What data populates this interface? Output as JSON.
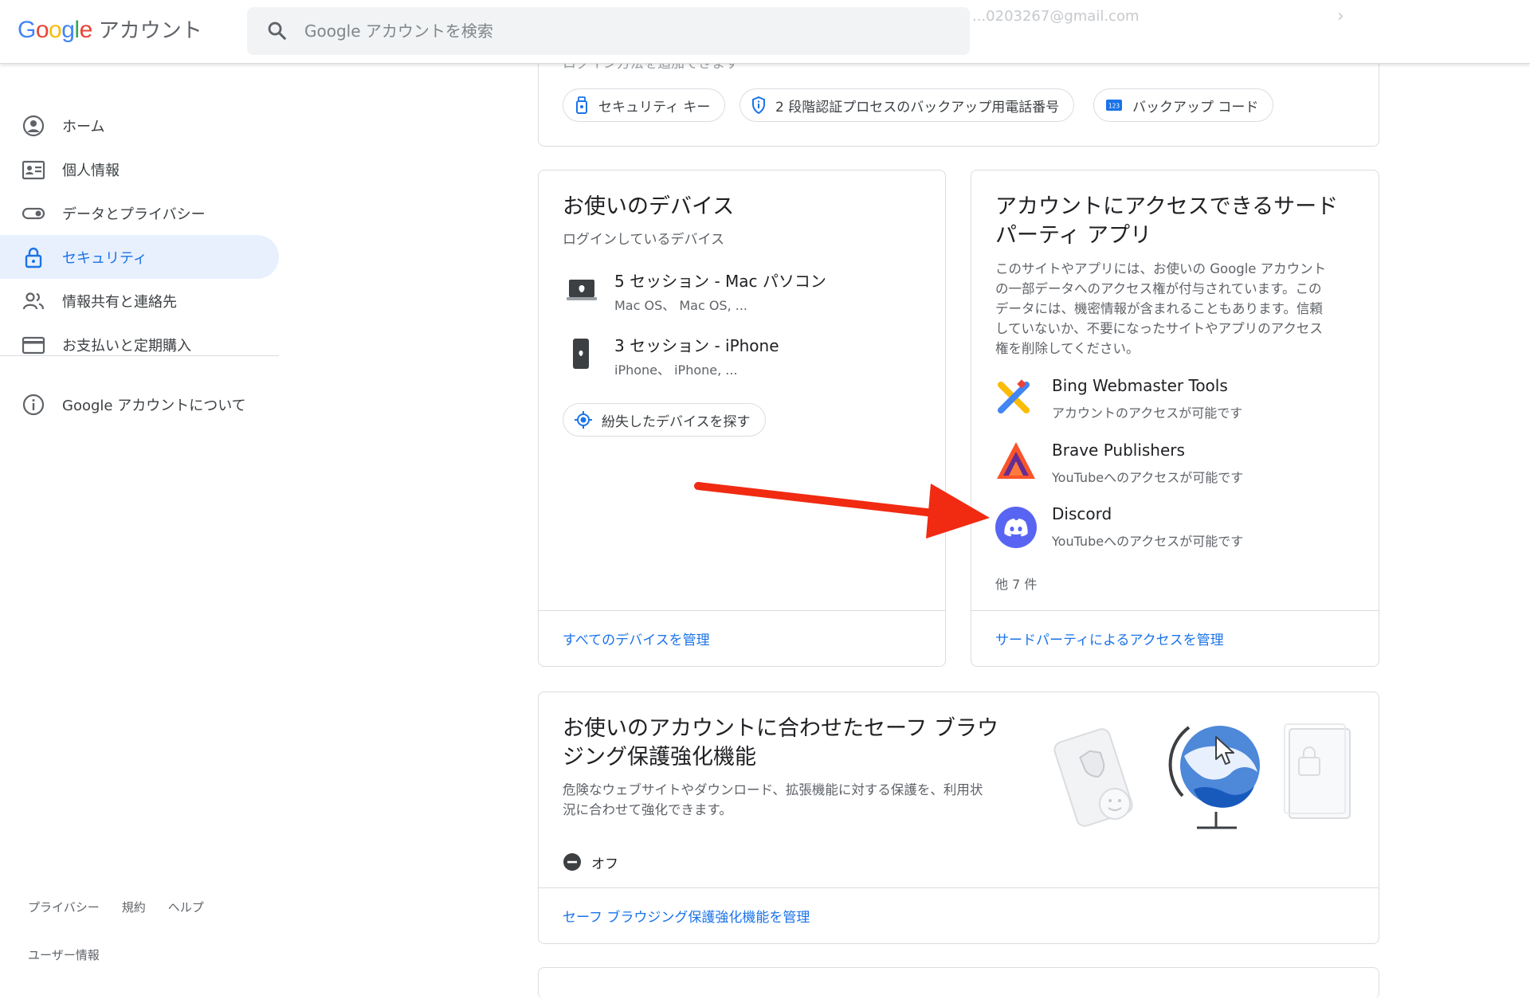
{
  "header": {
    "logo_letters": [
      "G",
      "o",
      "o",
      "g",
      "l",
      "e"
    ],
    "logo_colors": [
      "#4285f4",
      "#ea4335",
      "#fbbc05",
      "#4285f4",
      "#34a853",
      "#ea4335"
    ],
    "logo_suffix": "アカウント",
    "search_placeholder": "Google アカウントを検索",
    "email": "...0203267@gmail.com"
  },
  "sidebar": {
    "items": [
      {
        "label": "ホーム",
        "icon": "home-account-circle-icon"
      },
      {
        "label": "個人情報",
        "icon": "person-card-icon"
      },
      {
        "label": "データとプライバシー",
        "icon": "toggle-icon"
      },
      {
        "label": "セキュリティ",
        "icon": "lock-icon",
        "active": true
      },
      {
        "label": "情報共有と連絡先",
        "icon": "people-icon"
      },
      {
        "label": "お支払いと定期購入",
        "icon": "credit-card-icon"
      }
    ],
    "about": {
      "label": "Google アカウントについて",
      "icon": "info-icon"
    },
    "footer_links": [
      "プライバシー",
      "規約",
      "ヘルプ"
    ],
    "footer_userinfo": "ユーザー情報"
  },
  "signin_methods": {
    "cutoff_text": "ログイン方法を追加できます",
    "chips": [
      {
        "label": "セキュリティ キー",
        "icon": "security-key-icon"
      },
      {
        "label": "2 段階認証プロセスのバックアップ用電話番号",
        "icon": "shield-icon"
      },
      {
        "label": "バックアップ コード",
        "icon": "backup-code-icon",
        "icon_text": "123"
      }
    ]
  },
  "devices": {
    "title": "お使いのデバイス",
    "subtitle": "ログインしているデバイス",
    "rows": [
      {
        "title": "5 セッション - Mac パソコン",
        "sub": "Mac OS、 Mac OS, ...",
        "icon": "laptop-icon"
      },
      {
        "title": "3 セッション - iPhone",
        "sub": "iPhone、 iPhone, ...",
        "icon": "phone-icon"
      }
    ],
    "find_button": "紛失したデバイスを探す",
    "manage_link": "すべてのデバイスを管理"
  },
  "third_party": {
    "title_line1": "アカウントにアクセスできるサード",
    "title_line2": "パーティ アプリ",
    "description": [
      "このサイトやアプリには、お使いの Google アカウント",
      "の一部データへのアクセス権が付与されています。この",
      "データには、機密情報が含まれることもあります。信頼",
      "していないか、不要になったサイトやアプリのアクセス",
      "権を削除してください。"
    ],
    "apps": [
      {
        "name": "Bing Webmaster Tools",
        "access": "アカウントのアクセスが可能です",
        "icon": "bing-webmaster-icon"
      },
      {
        "name": "Brave Publishers",
        "access": "YouTubeへのアクセスが可能です",
        "icon": "brave-icon"
      },
      {
        "name": "Discord",
        "access": "YouTubeへのアクセスが可能です",
        "icon": "discord-icon"
      }
    ],
    "more": "他 7 件",
    "manage_link": "サードパーティによるアクセスを管理"
  },
  "safe_browsing": {
    "title_line1": "お使いのアカウントに合わせたセーフ ブラウ",
    "title_line2": "ジング保護強化機能",
    "description": [
      "危険なウェブサイトやダウンロード、拡張機能に対する保護を、利用状",
      "況に合わせて強化できます。"
    ],
    "status": "オフ",
    "manage_link": "セーフ ブラウジング保護強化機能を管理"
  },
  "colors": {
    "accent": "#1a73e8",
    "active_bg": "#e8f0fe",
    "annotation_arrow": "#f12a12",
    "discord": "#5865f2"
  }
}
